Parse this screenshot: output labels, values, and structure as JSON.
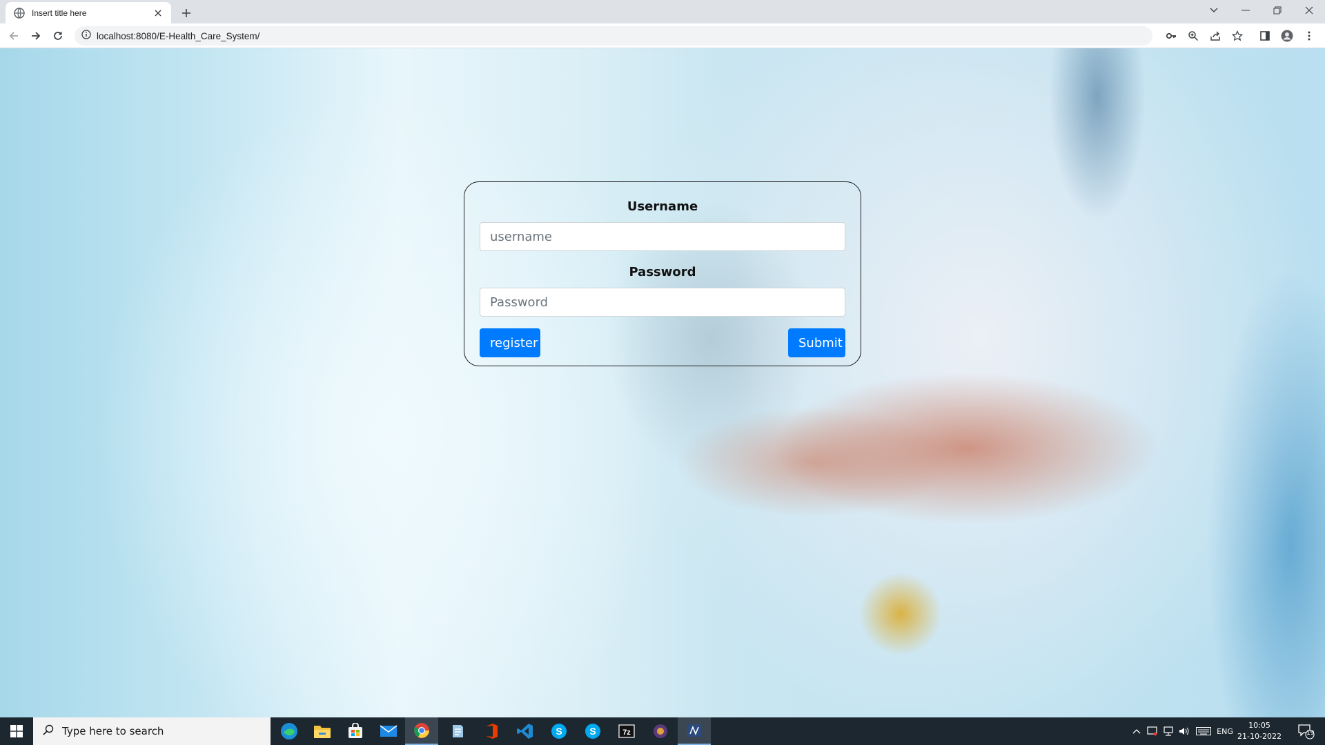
{
  "browser": {
    "tab_title": "Insert title here",
    "url": "localhost:8080/E-Health_Care_System/"
  },
  "form": {
    "username_label": "Username",
    "username_placeholder": "username",
    "username_value": "",
    "password_label": "Password",
    "password_placeholder": "Password",
    "password_value": "",
    "register_label": "register",
    "submit_label": "Submit"
  },
  "colors": {
    "primary_button": "#007bff",
    "taskbar": "#1c2730"
  },
  "taskbar": {
    "search_placeholder": "Type here to search",
    "apps": [
      "edge-icon",
      "file-explorer-icon",
      "store-icon",
      "mail-icon",
      "chrome-icon",
      "notepad-icon",
      "office-icon",
      "vscode-icon",
      "skype-icon",
      "skype-icon",
      "7zip-icon",
      "app-icon",
      "ide-icon"
    ],
    "language": "ENG",
    "time": "10:05",
    "date": "21-10-2022",
    "notification_count": "19"
  }
}
